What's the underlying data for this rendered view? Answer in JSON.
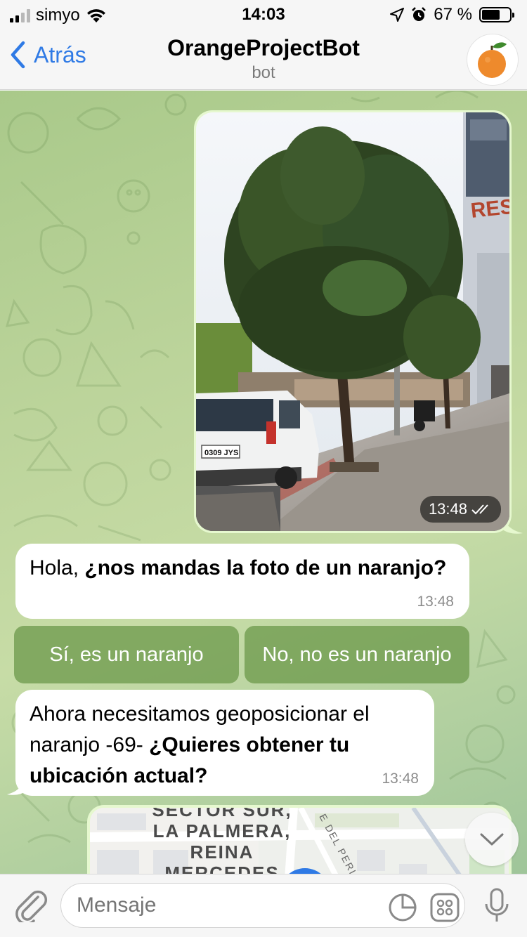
{
  "status": {
    "carrier": "simyo",
    "time": "14:03",
    "battery": "67 %",
    "battery_level": 0.67
  },
  "nav": {
    "back_label": "Atrás",
    "title": "OrangeProjectBot",
    "subtitle": "bot"
  },
  "messages": {
    "photo_time": "13:48",
    "greeting": {
      "plain": "Hola, ",
      "bold": "¿nos mandas la foto de un naranjo?",
      "time": "13:48"
    },
    "location": {
      "plain": "Ahora necesitamos geoposicionar el naranjo -69- ",
      "bold": "¿Quieres obtener tu ubicación actual?",
      "time": "13:48"
    }
  },
  "keyboard": {
    "yes_label": "Sí, es un naranjo",
    "no_label": "No, no es un naranjo"
  },
  "map": {
    "label1": "SECTOR SUR,",
    "label2": "LA PALMERA,",
    "label3": "REINA",
    "label4": "MERCEDES",
    "street": "E DEL PERIO"
  },
  "photo": {
    "plate": "0309 JYS",
    "sign": "RESI"
  },
  "input": {
    "placeholder": "Mensaje"
  }
}
